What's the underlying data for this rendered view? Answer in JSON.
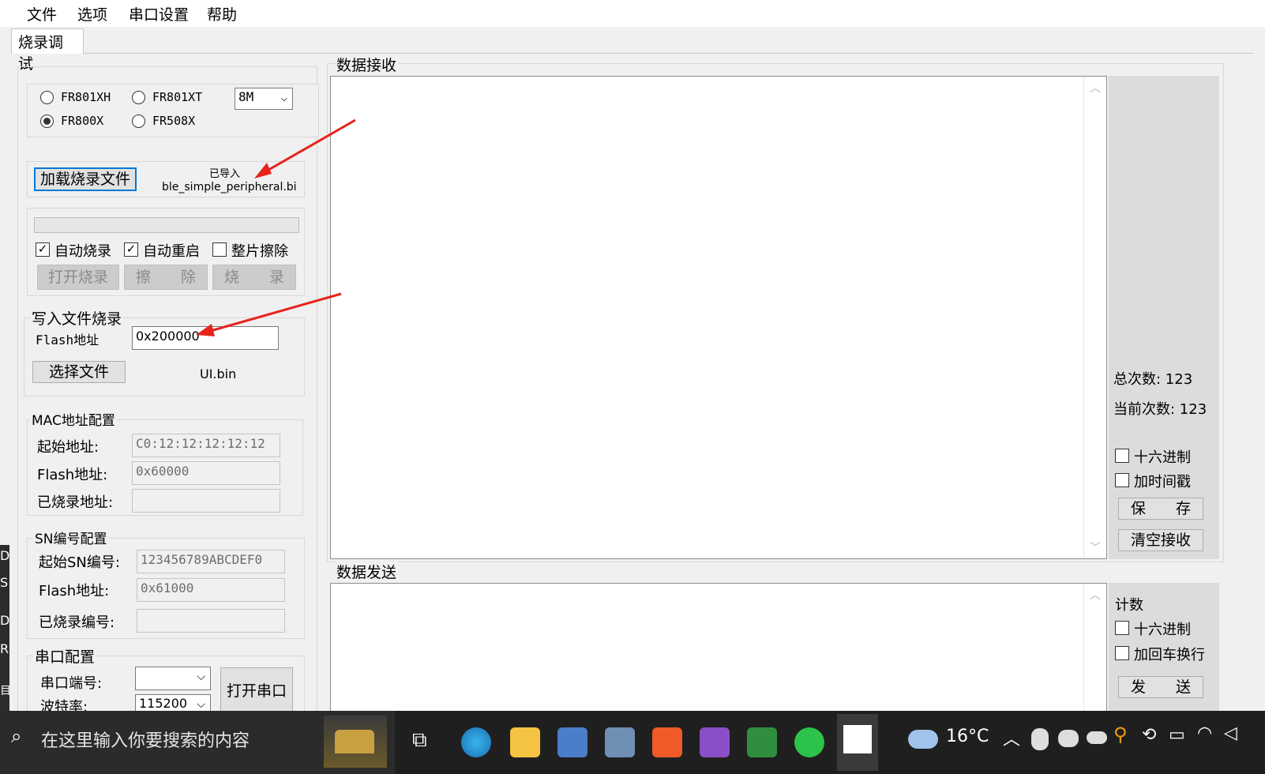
{
  "menubar": {
    "items": [
      "文件",
      "选项",
      "串口设置",
      "帮助"
    ]
  },
  "tab": {
    "label": "烧录调试"
  },
  "chip": {
    "options": [
      "FR801XH",
      "FR801XT",
      "FR800X",
      "FR508X"
    ],
    "selected": "FR800X",
    "size_value": "8M"
  },
  "load": {
    "button": "加载烧录文件",
    "status_line1": "已导入",
    "status_line2": "ble_simple_peripheral.bi"
  },
  "burn": {
    "auto_burn": "自动烧录",
    "auto_restart": "自动重启",
    "full_erase": "整片擦除",
    "auto_burn_checked": true,
    "auto_restart_checked": true,
    "full_erase_checked": false,
    "open_burn": "打开烧录",
    "erase": "擦　　除",
    "burn": "烧　　录"
  },
  "write_file": {
    "title": "写入文件烧录",
    "flash_label": "Flash地址",
    "flash_value": "0x200000",
    "select_button": "选择文件",
    "file_name": "UI.bin"
  },
  "mac": {
    "title": "MAC地址配置",
    "start_label": "起始地址:",
    "start_value": "C0:12:12:12:12:12",
    "flash_label": "Flash地址:",
    "flash_value": "0x60000",
    "burned_label": "已烧录地址:",
    "burned_value": ""
  },
  "sn": {
    "title": "SN编号配置",
    "start_label": "起始SN编号:",
    "start_value": "123456789ABCDEF0",
    "flash_label": "Flash地址:",
    "flash_value": "0x61000",
    "burned_label": "已烧录编号:",
    "burned_value": ""
  },
  "serial": {
    "title": "串口配置",
    "port_label": "串口端号:",
    "port_value": "",
    "baud_label": "波特率:",
    "baud_value": "115200",
    "open_button": "打开串口"
  },
  "receive": {
    "title": "数据接收",
    "total_count": "总次数: 123",
    "current_count": "当前次数: 123",
    "hex": "十六进制",
    "timestamp": "加时间戳",
    "save": "保　　存",
    "clear": "清空接收"
  },
  "send": {
    "title": "数据发送",
    "count_label": "计数",
    "hex": "十六进制",
    "crlf": "加回车换行",
    "send": "发　　送"
  },
  "edge_letters": [
    "D",
    "S",
    "D",
    "R",
    "目"
  ],
  "taskbar": {
    "search_placeholder": "在这里输入你要搜索的内容",
    "weather": "16°C",
    "icons": [
      "task-view-icon",
      "edge-icon",
      "file-explorer-icon",
      "city-app-icon",
      "calculator-icon",
      "player-icon",
      "visual-studio-icon",
      "vim-icon",
      "wechat-icon",
      "active-app-icon"
    ]
  },
  "colors": {
    "arrow": "#e8231c",
    "taskbar": "#1f1f1f"
  }
}
